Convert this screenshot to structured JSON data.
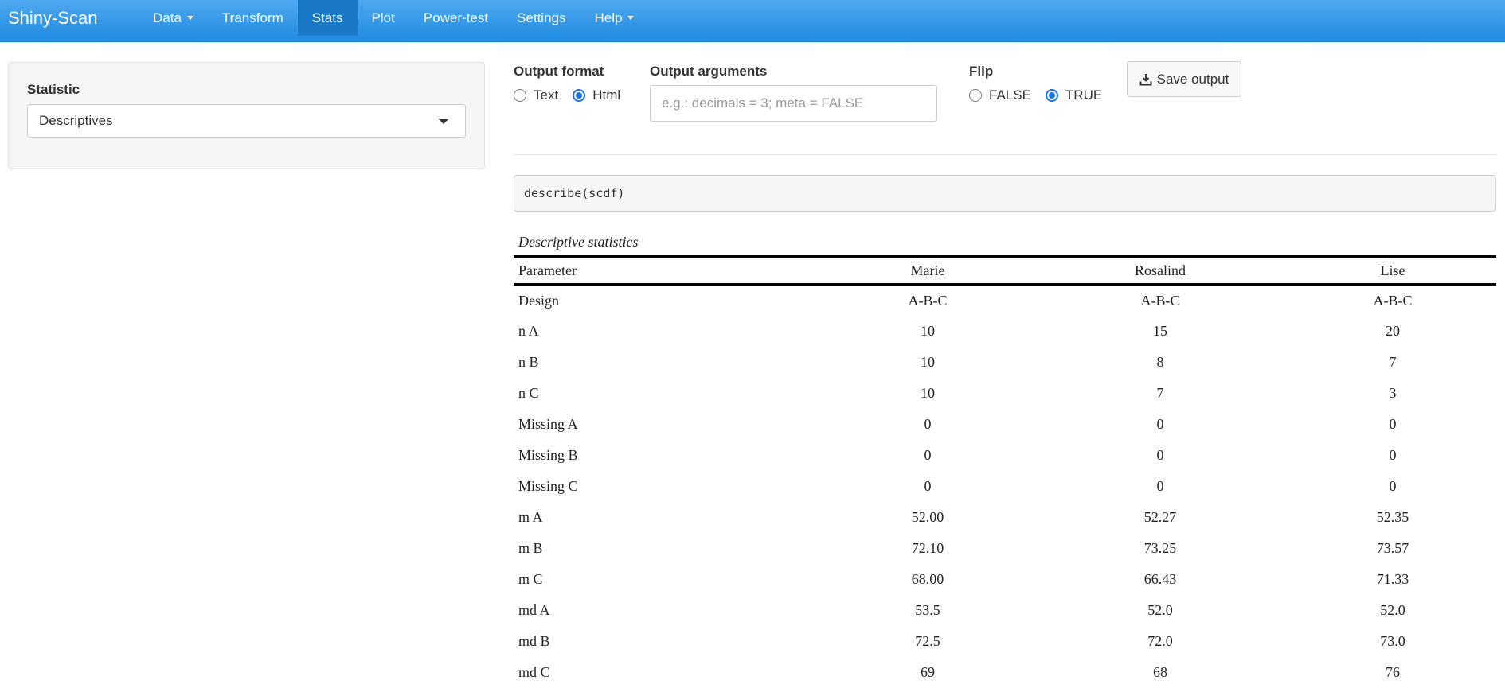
{
  "app": {
    "brand": "Shiny-Scan"
  },
  "nav": {
    "items": [
      {
        "label": "Data",
        "dropdown": true,
        "active": false
      },
      {
        "label": "Transform",
        "dropdown": false,
        "active": false
      },
      {
        "label": "Stats",
        "dropdown": false,
        "active": true
      },
      {
        "label": "Plot",
        "dropdown": false,
        "active": false
      },
      {
        "label": "Power-test",
        "dropdown": false,
        "active": false
      },
      {
        "label": "Settings",
        "dropdown": false,
        "active": false
      },
      {
        "label": "Help",
        "dropdown": true,
        "active": false
      }
    ]
  },
  "sidebar": {
    "statistic_label": "Statistic",
    "statistic_value": "Descriptives"
  },
  "controls": {
    "output_format": {
      "label": "Output format",
      "options": [
        {
          "label": "Text",
          "checked": false
        },
        {
          "label": "Html",
          "checked": true
        }
      ]
    },
    "output_arguments": {
      "label": "Output arguments",
      "placeholder": "e.g.: decimals = 3; meta = FALSE",
      "value": ""
    },
    "flip": {
      "label": "Flip",
      "options": [
        {
          "label": "FALSE",
          "checked": false
        },
        {
          "label": "TRUE",
          "checked": true
        }
      ]
    },
    "save_button": {
      "label": "Save output",
      "icon": "download-icon"
    }
  },
  "code": "describe(scdf)",
  "table": {
    "caption": "Descriptive statistics",
    "headers": [
      "Parameter",
      "Marie",
      "Rosalind",
      "Lise"
    ],
    "rows": [
      [
        "Design",
        "A-B-C",
        "A-B-C",
        "A-B-C"
      ],
      [
        "n A",
        "10",
        "15",
        "20"
      ],
      [
        "n B",
        "10",
        "8",
        "7"
      ],
      [
        "n C",
        "10",
        "7",
        "3"
      ],
      [
        "Missing A",
        "0",
        "0",
        "0"
      ],
      [
        "Missing B",
        "0",
        "0",
        "0"
      ],
      [
        "Missing C",
        "0",
        "0",
        "0"
      ],
      [
        "m A",
        "52.00",
        "52.27",
        "52.35"
      ],
      [
        "m B",
        "72.10",
        "73.25",
        "73.57"
      ],
      [
        "m C",
        "68.00",
        "66.43",
        "71.33"
      ],
      [
        "md A",
        "53.5",
        "52.0",
        "52.0"
      ],
      [
        "md B",
        "72.5",
        "72.0",
        "73.0"
      ],
      [
        "md C",
        "69",
        "68",
        "76"
      ]
    ]
  },
  "colors": {
    "navbar": "#2196f3",
    "active_tab": "#1a78c9",
    "radio_accent": "#1a73e8"
  }
}
